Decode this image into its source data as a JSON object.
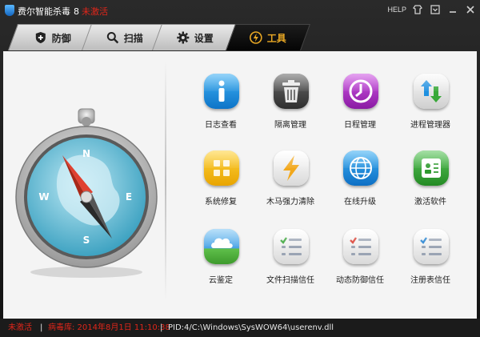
{
  "window": {
    "title": "费尔智能杀毒",
    "version": "8",
    "edition": "未激活",
    "help_label": "HELP",
    "controls": [
      "skin-icon",
      "menu-icon",
      "minimize-icon",
      "close-icon"
    ]
  },
  "tabs": [
    {
      "label": "防御",
      "icon": "shield-icon",
      "active": false
    },
    {
      "label": "扫描",
      "icon": "magnifier-icon",
      "active": false
    },
    {
      "label": "设置",
      "icon": "gear-icon",
      "active": false
    },
    {
      "label": "工具",
      "icon": "lightning-icon",
      "active": true
    }
  ],
  "tools": [
    {
      "label": "日志查看",
      "icon": "info-icon",
      "color": "#1e8fe0"
    },
    {
      "label": "隔离管理",
      "icon": "trash-icon",
      "color": "#4a4a4a"
    },
    {
      "label": "日程管理",
      "icon": "clock-icon",
      "color": "#b02fc8"
    },
    {
      "label": "进程管理器",
      "icon": "updown-arrows-icon",
      "color": "#e8e8e8"
    },
    {
      "label": "系统修复",
      "icon": "tiles-icon",
      "color": "#f0b700"
    },
    {
      "label": "木马强力清除",
      "icon": "lightning-icon",
      "color": "#eeeeee"
    },
    {
      "label": "在线升级",
      "icon": "globe-icon",
      "color": "#1a8ae0"
    },
    {
      "label": "激活软件",
      "icon": "id-card-icon",
      "color": "#36a336"
    },
    {
      "label": "云鉴定",
      "icon": "cloud-icon",
      "color": "#4aa3e6"
    },
    {
      "label": "文件扫描信任",
      "icon": "checklist-icon",
      "color": "#eeeeee"
    },
    {
      "label": "动态防御信任",
      "icon": "checklist-icon",
      "color": "#eeeeee"
    },
    {
      "label": "注册表信任",
      "icon": "checklist-icon",
      "color": "#eeeeee"
    }
  ],
  "compass": {
    "icon": "compass-icon",
    "letters": {
      "n": "N",
      "e": "E",
      "s": "S",
      "w": "W"
    }
  },
  "status": {
    "activation": "未激活",
    "virus_db": "病毒库: 2014年8月1日 11:10:38",
    "separator": "|",
    "process": "PID:4/C:\\Windows\\SysWOW64\\userenv.dll"
  }
}
